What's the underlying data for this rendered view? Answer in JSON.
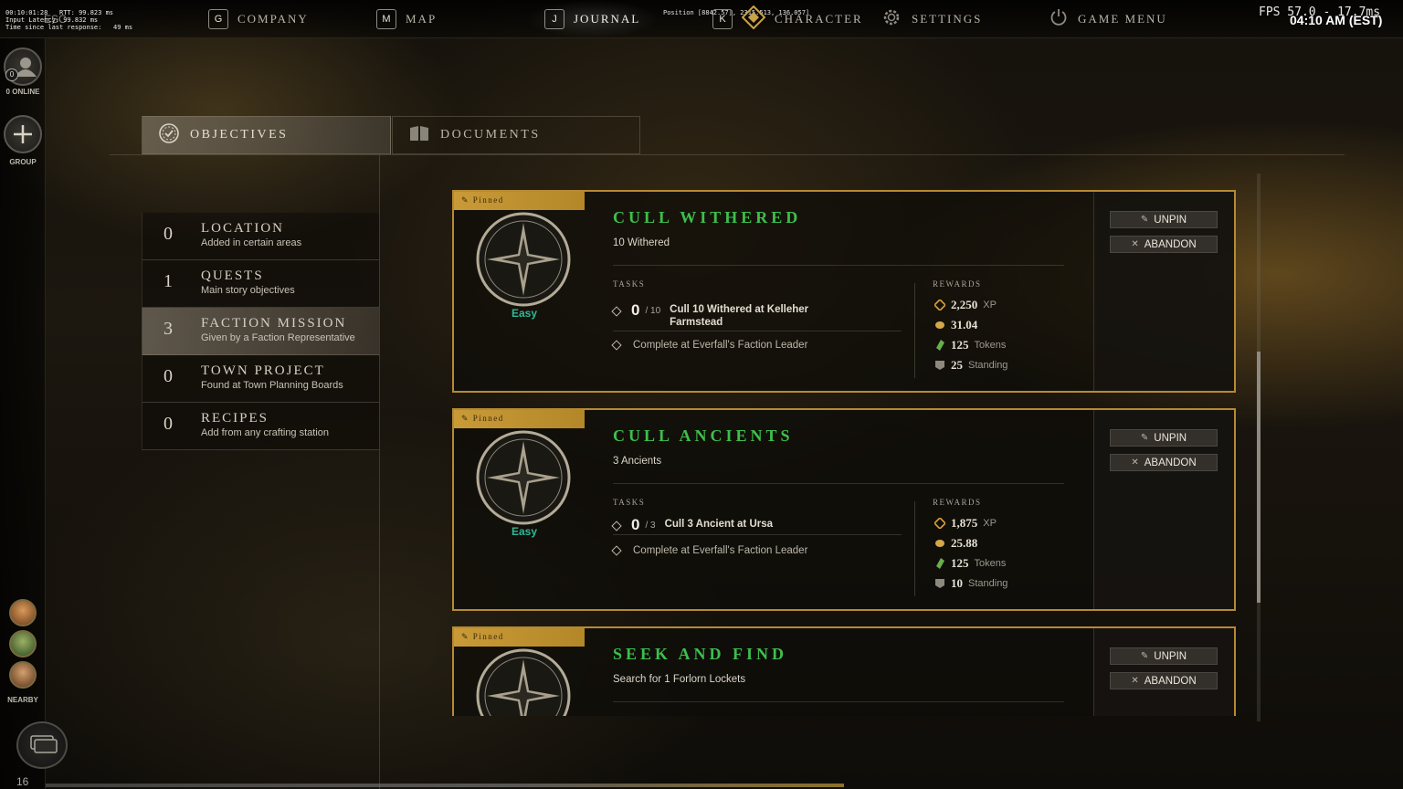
{
  "debug": {
    "lines": [
      "00:10:01:28   RTT: 99.823 ms",
      "Input Latency: 99.832 ms",
      "Time since last response:   49 ms"
    ],
    "esc_key": "ESC",
    "position": "Position [8842.57], 2315.513, 136.057]",
    "fps": "FPS 57.0 - 17.7ms"
  },
  "clock": "04:10 AM (EST)",
  "nav": [
    {
      "key": "G",
      "label": "COMPANY"
    },
    {
      "key": "M",
      "label": "MAP"
    },
    {
      "key": "J",
      "label": "JOURNAL"
    },
    {
      "key": "K",
      "label": "CHARACTER"
    },
    {
      "key": "",
      "label": "SETTINGS"
    },
    {
      "key": "",
      "label": "GAME MENU"
    }
  ],
  "rail": {
    "online_count": "0",
    "online_label": "0 ONLINE",
    "group_label": "GROUP",
    "nearby_label": "NEARBY",
    "bottom_number": "16"
  },
  "tabs": {
    "objectives": "OBJECTIVES",
    "documents": "DOCUMENTS"
  },
  "categories": [
    {
      "count": "0",
      "title": "LOCATION",
      "subtitle": "Added in certain areas"
    },
    {
      "count": "1",
      "title": "QUESTS",
      "subtitle": "Main story objectives"
    },
    {
      "count": "3",
      "title": "FACTION MISSION",
      "subtitle": "Given by a Faction Representative"
    },
    {
      "count": "0",
      "title": "TOWN PROJECT",
      "subtitle": "Found at Town Planning Boards"
    },
    {
      "count": "0",
      "title": "RECIPES",
      "subtitle": "Add from any crafting station"
    }
  ],
  "missions": [
    {
      "pinned": "Pinned",
      "title": "CULL WITHERED",
      "description": "10 Withered",
      "difficulty": "Easy",
      "tasks_label": "TASKS",
      "rewards_label": "REWARDS",
      "task": {
        "count": "0",
        "total": "/ 10",
        "text": "Cull 10 Withered at Kelleher Farmstead"
      },
      "complete": "Complete at Everfall's Faction Leader",
      "rewards": [
        {
          "value": "2,250",
          "unit": "XP"
        },
        {
          "value": "31.04",
          "unit": ""
        },
        {
          "value": "125",
          "unit": "Tokens"
        },
        {
          "value": "25",
          "unit": "Standing"
        }
      ],
      "unpin": "UNPIN",
      "abandon": "ABANDON"
    },
    {
      "pinned": "Pinned",
      "title": "CULL ANCIENTS",
      "description": "3 Ancients",
      "difficulty": "Easy",
      "tasks_label": "TASKS",
      "rewards_label": "REWARDS",
      "task": {
        "count": "0",
        "total": "/ 3",
        "text": "Cull 3 Ancient at Ursa"
      },
      "complete": "Complete at Everfall's Faction Leader",
      "rewards": [
        {
          "value": "1,875",
          "unit": "XP"
        },
        {
          "value": "25.88",
          "unit": ""
        },
        {
          "value": "125",
          "unit": "Tokens"
        },
        {
          "value": "10",
          "unit": "Standing"
        }
      ],
      "unpin": "UNPIN",
      "abandon": "ABANDON"
    },
    {
      "pinned": "Pinned",
      "title": "SEEK AND FIND",
      "description": "Search for 1 Forlorn Lockets",
      "unpin": "UNPIN",
      "abandon": "ABANDON"
    }
  ],
  "colors": {
    "accent_gold": "#b68a33",
    "mission_title": "#3dbf4c",
    "difficulty_easy": "#2fb895"
  }
}
